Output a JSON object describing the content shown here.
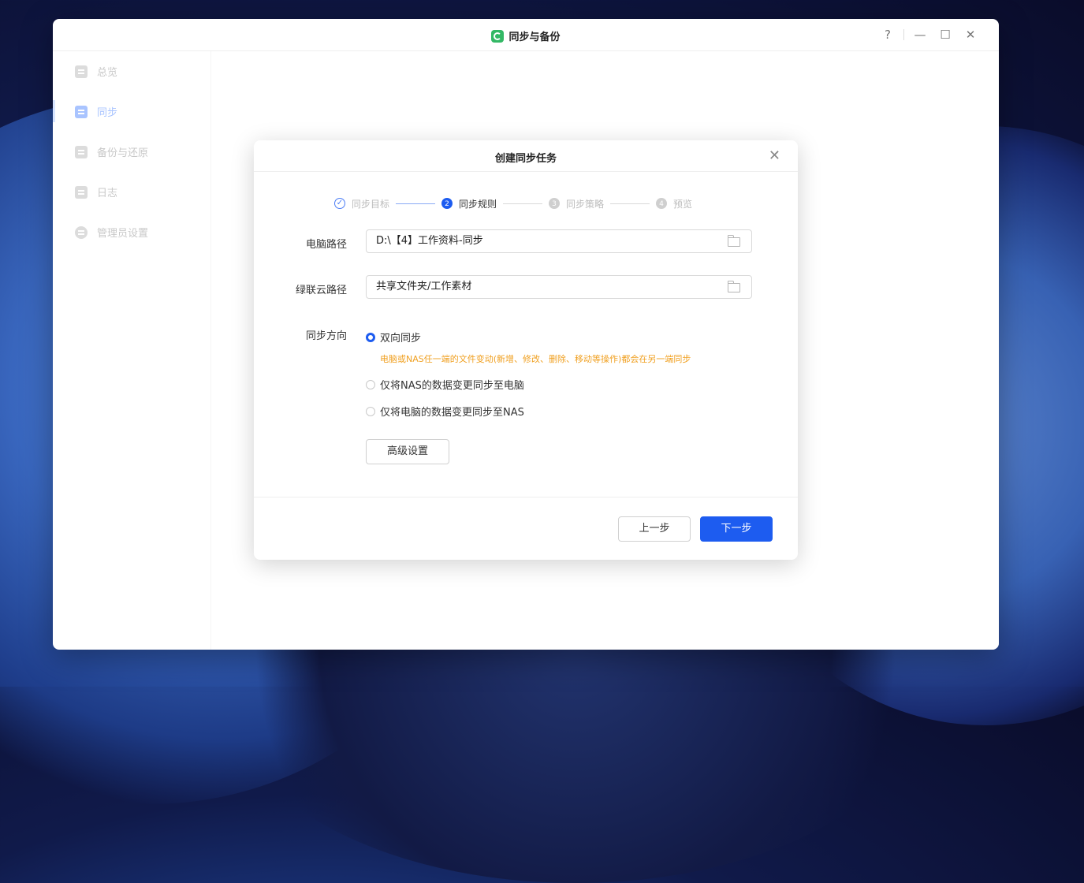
{
  "app": {
    "title": "同步与备份",
    "help": "?",
    "minimize": "—",
    "maximize": "☐",
    "close": "✕"
  },
  "sidebar": {
    "items": [
      {
        "label": "总览"
      },
      {
        "label": "同步"
      },
      {
        "label": "备份与还原"
      },
      {
        "label": "日志"
      },
      {
        "label": "管理员设置"
      }
    ]
  },
  "dialog": {
    "title": "创建同步任务",
    "close": "✕",
    "steps": [
      {
        "num": "✓",
        "label": "同步目标"
      },
      {
        "num": "2",
        "label": "同步规则"
      },
      {
        "num": "3",
        "label": "同步策略"
      },
      {
        "num": "4",
        "label": "预览"
      }
    ],
    "pc_path_label": "电脑路径",
    "pc_path_value": "D:\\【4】工作资料-同步",
    "cloud_path_label": "绿联云路径",
    "cloud_path_value": "共享文件夹/工作素材",
    "direction_label": "同步方向",
    "options": [
      {
        "label": "双向同步",
        "checked": true
      },
      {
        "label": "仅将NAS的数据变更同步至电脑",
        "checked": false
      },
      {
        "label": "仅将电脑的数据变更同步至NAS",
        "checked": false
      }
    ],
    "hint": "电脑或NAS任一端的文件变动(新增、修改、删除、移动等操作)都会在另一端同步",
    "advanced": "高级设置",
    "prev": "上一步",
    "next": "下一步"
  },
  "colors": {
    "primary": "#1d5cf0",
    "hint": "#f0a021",
    "app_logo": "#33b865"
  }
}
